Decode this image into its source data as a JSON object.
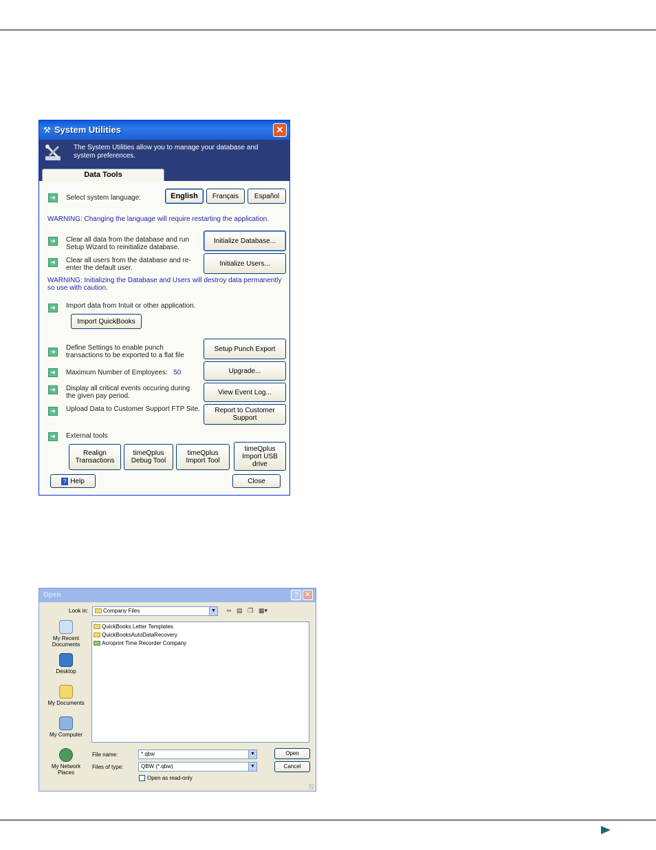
{
  "system_utilities": {
    "title": "System Utilities",
    "description": "The System Utilities allow you to manage your database and system preferences.",
    "tab_label": "Data Tools",
    "language_label": "Select system language:",
    "lang_english": "English",
    "lang_french": "Français",
    "lang_spanish": "Español",
    "warning_language": "WARNING:  Changing the language will require restarting the application.",
    "clear_data_text": "Clear all data from the database and run Setup Wizard to reinitialize database.",
    "init_db_button": "Initialize Database...",
    "clear_users_text": "Clear all users from the  database and re-enter the default user.",
    "init_users_button": "Initialize Users...",
    "warning_init": "WARNING:  Initializing the Database and Users will destroy data permanently so use with caution.",
    "import_text": "Import data from Intuit or other application.",
    "import_qb_button": "Import QuickBooks",
    "punch_text": "Define Settings to enable punch transactions to be exported to a flat file",
    "punch_button": "Setup Punch Export",
    "max_emp_label": "Maximum Number of Employees:",
    "max_emp_value": "50",
    "upgrade_button": "Upgrade...",
    "events_text": "Display all critical events occuring during the given pay period.",
    "event_log_button": "View Event Log...",
    "upload_text": "Upload Data to Customer Support FTP Site.",
    "report_button": "Report to Customer Support",
    "external_label": "External tools",
    "ext_realign": "Realign Transactions",
    "ext_debug": "timeQplus Debug Tool",
    "ext_import": "timeQplus Import Tool",
    "ext_usb": "timeQplus Import USB drive",
    "help_button": "Help",
    "close_button": "Close"
  },
  "open_dialog": {
    "title": "Open",
    "look_in_label": "Look in:",
    "look_in_value": "Company Files",
    "files": [
      "QuickBooks Letter Templates",
      "QuickBooksAutoDataRecovery",
      "Acroprint Time Recorder Company"
    ],
    "places": [
      "My Recent Documents",
      "Desktop",
      "My Documents",
      "My Computer",
      "My Network Places"
    ],
    "file_name_label": "File name:",
    "file_name_value": "*.qbw",
    "files_of_type_label": "Files of type:",
    "files_of_type_value": "QBW (*.qbw)",
    "open_readonly": "Open as read-only",
    "open_button": "Open",
    "cancel_button": "Cancel",
    "help_glyph": "?",
    "close_glyph": "✕"
  },
  "icons": {
    "row_arrow": "arrow-right-icon",
    "window_close": "close-icon",
    "next_page": "next-page-arrow-icon"
  },
  "colors": {
    "warning_text": "#1f1fb0",
    "banner": "#2a3d7a",
    "xp_title": "#0a5ad8"
  }
}
